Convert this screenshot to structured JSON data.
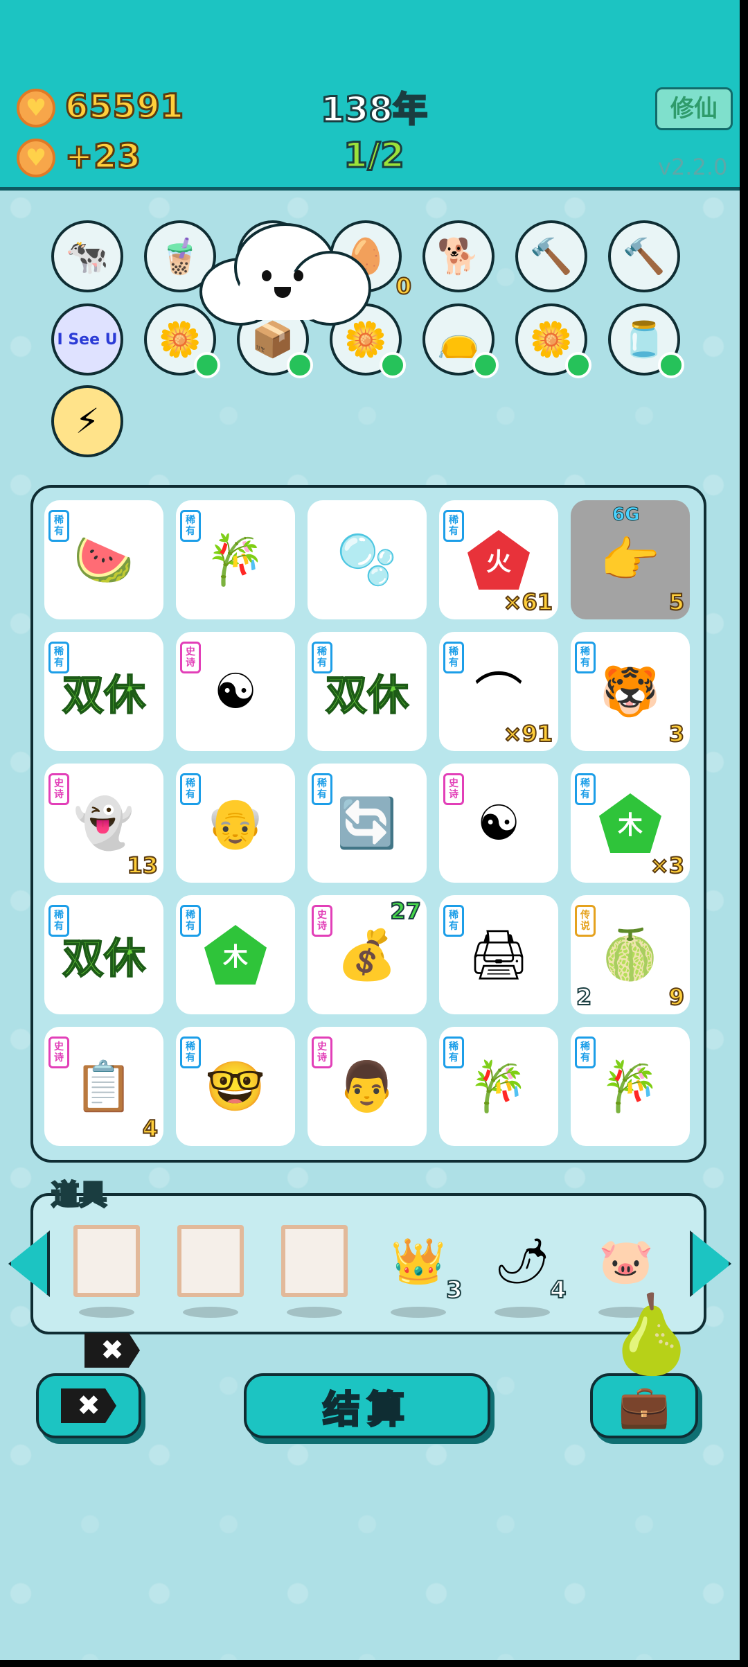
{
  "header": {
    "gold": "65591",
    "income": "+23",
    "year": "138年",
    "progress": "1/2",
    "mode_button": "修仙",
    "version": "v2.2.0"
  },
  "badges": [
    {
      "icon": "🐄",
      "name": "cow-couple-icon"
    },
    {
      "icon": "🧋",
      "name": "bubble-tea-icon"
    },
    {
      "icon": "📘",
      "name": "book-icon"
    },
    {
      "icon": "🥚",
      "name": "egg-tray-icon",
      "count": "0"
    },
    {
      "icon": "🐕",
      "name": "cool-dog-icon"
    },
    {
      "icon": "🔨",
      "name": "hammer-icon"
    },
    {
      "icon": "🔨",
      "name": "hammer-icon-2"
    },
    {
      "icon": "I See U",
      "name": "i-see-u-icon"
    },
    {
      "icon": "🌼",
      "name": "potted-flower-icon"
    },
    {
      "icon": "📦",
      "name": "parcel-icon"
    },
    {
      "icon": "🌼",
      "name": "potted-flower-icon-2"
    },
    {
      "icon": "👝",
      "name": "sack-icon"
    },
    {
      "icon": "🌼",
      "name": "potted-flower-icon-3"
    },
    {
      "icon": "🫙",
      "name": "jar-icon"
    },
    {
      "icon": "⚡",
      "name": "lightning-icon"
    }
  ],
  "board": {
    "tags": {
      "rare": "稀有",
      "epic": "史诗",
      "legend": "传说"
    },
    "cells": [
      {
        "tag": "rare",
        "icon": "🍉",
        "name": "watermelon-slice-icon"
      },
      {
        "tag": "rare",
        "icon": "🎋",
        "name": "bamboo-icon"
      },
      {
        "tag": "",
        "icon": "🫧",
        "name": "bubble-icon"
      },
      {
        "tag": "rare",
        "icon": "火",
        "name": "fire-element-icon",
        "count": "×61",
        "color": "#e8323a"
      },
      {
        "tag": "",
        "icon": "👉",
        "name": "pointing-hand-icon",
        "count": "5",
        "top": "6G",
        "gray": true
      },
      {
        "tag": "rare",
        "icon": "双休",
        "name": "double-rest-icon",
        "text": true
      },
      {
        "tag": "epic",
        "icon": "☯",
        "name": "bagua-icon"
      },
      {
        "tag": "rare",
        "icon": "双休",
        "name": "double-rest-icon-2",
        "text": true
      },
      {
        "tag": "rare",
        "icon": "⌒",
        "name": "speedometer-icon",
        "count": "×91"
      },
      {
        "tag": "rare",
        "icon": "🐯",
        "name": "tiger-icon",
        "count": "3"
      },
      {
        "tag": "epic",
        "icon": "👻",
        "name": "ghost-icon",
        "count": "13"
      },
      {
        "tag": "rare",
        "icon": "👴",
        "name": "bald-man-icon"
      },
      {
        "tag": "rare",
        "icon": "🔄",
        "name": "recycle-pot-icon"
      },
      {
        "tag": "epic",
        "icon": "☯",
        "name": "bagua-icon-2"
      },
      {
        "tag": "rare",
        "icon": "木",
        "name": "wood-element-icon",
        "count": "×3",
        "color": "#2fc43a"
      },
      {
        "tag": "rare",
        "icon": "双休",
        "name": "double-rest-icon-3",
        "text": true
      },
      {
        "tag": "rare",
        "icon": "木",
        "name": "wood-element-icon-2",
        "color": "#2fc43a"
      },
      {
        "tag": "epic",
        "icon": "💰",
        "name": "coin-cycle-icon",
        "topcount": "27"
      },
      {
        "tag": "rare",
        "icon": "🖨",
        "name": "printer-icon"
      },
      {
        "tag": "legend",
        "icon": "🍈",
        "name": "giant-melon-icon",
        "count": "9",
        "leftcount": "2"
      },
      {
        "tag": "epic",
        "icon": "📋",
        "name": "copy-paste-icon",
        "count": "4"
      },
      {
        "tag": "rare",
        "icon": "🤓",
        "name": "nerd-face-icon"
      },
      {
        "tag": "epic",
        "icon": "👨",
        "name": "glasses-man-icon"
      },
      {
        "tag": "rare",
        "icon": "🎋",
        "name": "bamboo-icon-2"
      },
      {
        "tag": "rare",
        "icon": "🎋",
        "name": "bamboo-icon-3"
      }
    ]
  },
  "tools": {
    "label": "道具",
    "items": [
      {
        "kind": "slot",
        "name": "empty-frame-icon"
      },
      {
        "kind": "slot",
        "name": "empty-frame-icon-2"
      },
      {
        "kind": "slot",
        "name": "empty-frame-icon-3"
      },
      {
        "kind": "item",
        "icon": "👑",
        "name": "crown-icon",
        "count": "3"
      },
      {
        "kind": "item",
        "icon": "🌶",
        "name": "chili-icon",
        "count": "4"
      },
      {
        "kind": "item",
        "icon": "🐷",
        "name": "piggy-bank-icon",
        "count": ""
      }
    ]
  },
  "actions": {
    "settle": "结算",
    "close_glyph": "✖"
  }
}
